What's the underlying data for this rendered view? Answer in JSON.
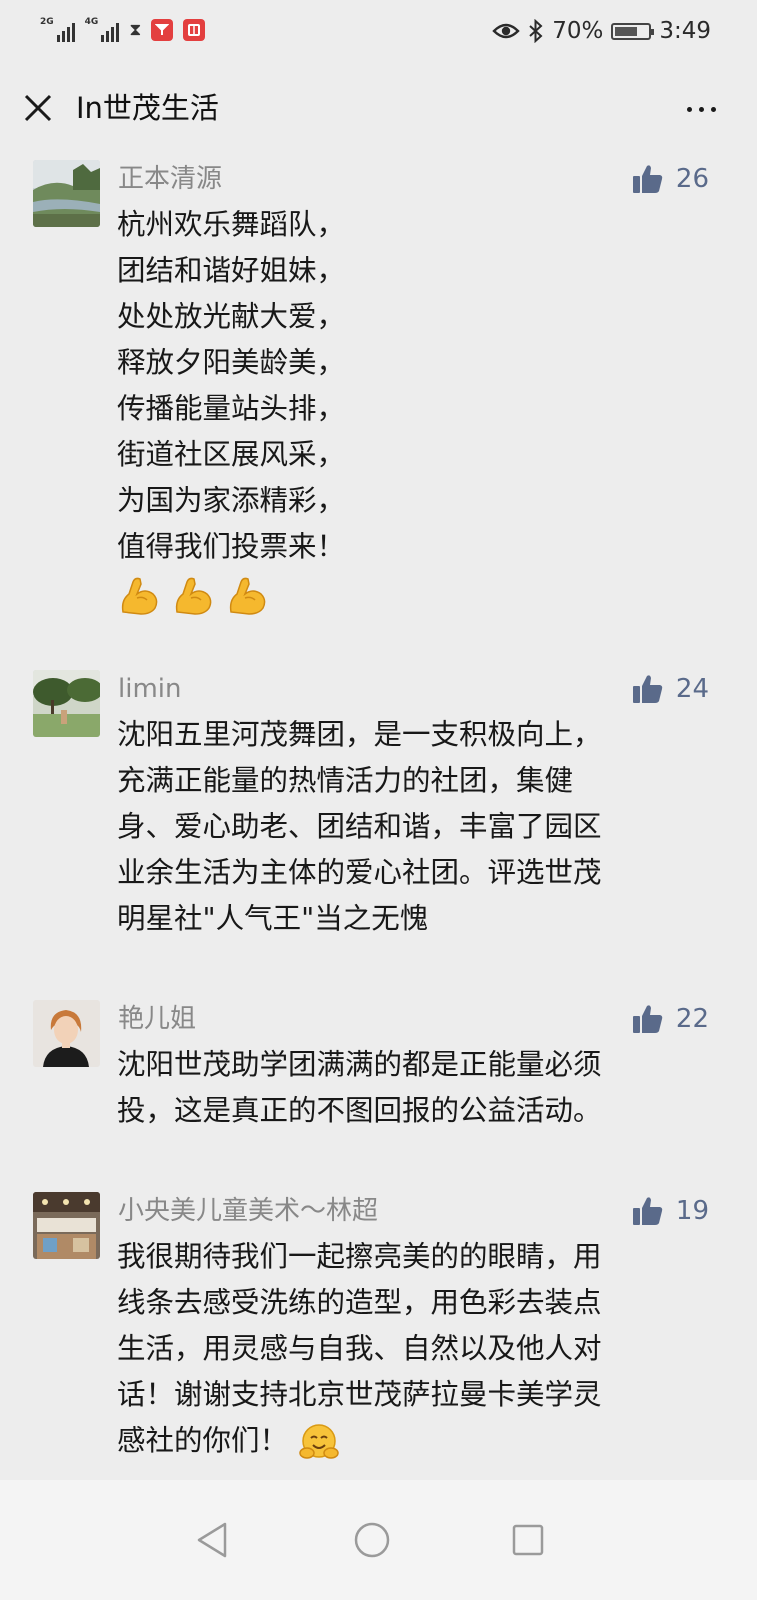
{
  "status_bar": {
    "signal_1_label": "2G",
    "signal_2_label": "4G",
    "battery_percent": "70%",
    "battery_level": 0.7,
    "time": "3:49"
  },
  "header": {
    "title": "In世茂生活"
  },
  "comments": [
    {
      "author": "正本清源",
      "likes": "26",
      "lines": [
        "杭州欢乐舞蹈队，",
        "团结和谐好姐妹，",
        "处处放光献大爱，",
        "释放夕阳美龄美，",
        "传播能量站头排，",
        "街道社区展风采，",
        "为国为家添精彩，",
        "值得我们投票来！"
      ],
      "emoji": [
        "flexed-biceps",
        "flexed-biceps",
        "flexed-biceps"
      ]
    },
    {
      "author": "limin",
      "likes": "24",
      "lines": [
        "沈阳五里河茂舞团，是一支积极向上，",
        "充满正能量的热情活力的社团，集健",
        "身、爱心助老、团结和谐，丰富了园区",
        "业余生活为主体的爱心社团。评选世茂",
        "明星社\"人气王\"当之无愧"
      ]
    },
    {
      "author": "艳儿姐",
      "likes": "22",
      "lines": [
        "沈阳世茂助学团满满的都是正能量必须",
        "投，这是真正的不图回报的公益活动。"
      ]
    },
    {
      "author": "小央美儿童美术～林超",
      "likes": "19",
      "lines": [
        "我很期待我们一起擦亮美的的眼睛，用",
        "线条去感受洗练的造型，用色彩去装点",
        "生活，用灵感与自我、自然以及他人对",
        "话！谢谢支持北京世茂萨拉曼卡美学灵",
        "感社的你们！"
      ],
      "trailing_emoji": "hugging-face"
    }
  ],
  "colors": {
    "background": "#ededed",
    "author_gray": "#888888",
    "like_blue": "#5a6a8a",
    "text": "#181818"
  }
}
